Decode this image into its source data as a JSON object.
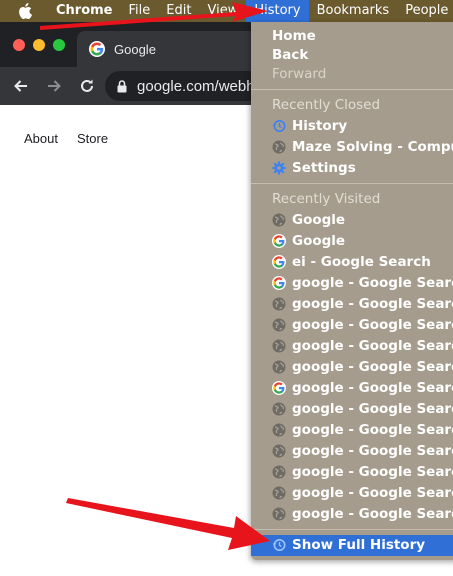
{
  "menubar": {
    "apple_icon": "apple-logo-icon",
    "items": [
      "Chrome",
      "File",
      "Edit",
      "View",
      "History",
      "Bookmarks",
      "People"
    ],
    "active": "History",
    "bg": "#6b5a2e",
    "active_bg": "#2f6fd6"
  },
  "tab": {
    "title": "Google",
    "favicon": "google-g-icon"
  },
  "omnibox": {
    "url": "google.com/webh",
    "icon": "lock-icon"
  },
  "page_links": [
    "About",
    "Store"
  ],
  "history_menu": {
    "nav": [
      "Home",
      "Back",
      "Forward"
    ],
    "recently_closed_header": "Recently Closed",
    "recently_closed": [
      {
        "label": "History",
        "icon": "history-clock-icon"
      },
      {
        "label": "Maze Solving - Computer",
        "icon": "globe-icon"
      },
      {
        "label": "Settings",
        "icon": "gear-icon"
      }
    ],
    "recently_visited_header": "Recently Visited",
    "recently_visited": [
      {
        "label": "Google",
        "icon": "globe-icon"
      },
      {
        "label": "Google",
        "icon": "google-g-icon"
      },
      {
        "label": "ei - Google Search",
        "icon": "google-g-icon"
      },
      {
        "label": "google - Google Search",
        "icon": "google-g-icon"
      },
      {
        "label": "google - Google Search",
        "icon": "globe-icon"
      },
      {
        "label": "google - Google Search",
        "icon": "globe-icon"
      },
      {
        "label": "google - Google Search",
        "icon": "globe-icon"
      },
      {
        "label": "google - Google Search",
        "icon": "globe-icon"
      },
      {
        "label": "google - Google Search",
        "icon": "google-g-icon"
      },
      {
        "label": "google - Google Search",
        "icon": "globe-icon"
      },
      {
        "label": "google - Google Search",
        "icon": "globe-icon"
      },
      {
        "label": "google - Google Search",
        "icon": "globe-icon"
      },
      {
        "label": "google - Google Search",
        "icon": "globe-icon"
      },
      {
        "label": "google - Google Search",
        "icon": "globe-icon"
      },
      {
        "label": "google - Google Search",
        "icon": "globe-icon"
      }
    ],
    "show_full": {
      "label": "Show Full History",
      "icon": "history-clock-icon"
    },
    "selected_color": "#2f6fd6",
    "bg": "#a59c8d"
  },
  "annotation": {
    "arrow_color": "#e8141b"
  }
}
